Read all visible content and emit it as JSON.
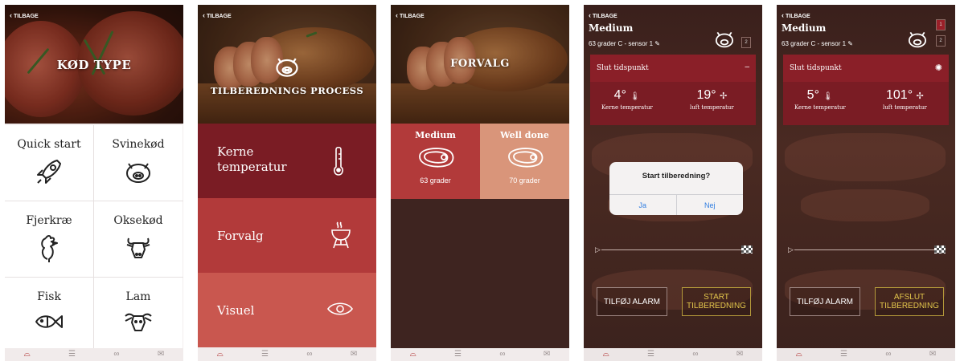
{
  "common": {
    "back_label": "TILBAGE",
    "tab_icons": [
      "pot-icon",
      "sliders-icon",
      "sensor-icon",
      "mail-icon"
    ]
  },
  "colors": {
    "dark_red": "#7a1c24",
    "mid_red": "#b23a3a",
    "light_red": "#c9574f",
    "peach": "#d9957a",
    "dark_brown": "#3e2420",
    "gold": "#e2c54b"
  },
  "screen1": {
    "title": "KØD TYPE",
    "categories": [
      {
        "label": "Quick start",
        "icon": "rocket-icon"
      },
      {
        "label": "Svinekød",
        "icon": "pig-icon"
      },
      {
        "label": "Fjerkræ",
        "icon": "chicken-icon"
      },
      {
        "label": "Oksekød",
        "icon": "cow-icon"
      },
      {
        "label": "Fisk",
        "icon": "fish-icon"
      },
      {
        "label": "Lam",
        "icon": "sheep-icon"
      }
    ]
  },
  "screen2": {
    "title": "TILBEREDNINGS PROCESS",
    "options": [
      {
        "label": "Kerne temperatur",
        "icon": "thermometer-icon"
      },
      {
        "label": "Forvalg",
        "icon": "grill-icon"
      },
      {
        "label": "Visuel",
        "icon": "eye-icon"
      }
    ]
  },
  "screen3": {
    "title": "FORVALG",
    "options": [
      {
        "label": "Medium",
        "value": "63 grader",
        "icon": "steak-icon"
      },
      {
        "label": "Well done",
        "value": "70 grader",
        "icon": "steak-icon"
      }
    ]
  },
  "screen4": {
    "title": "Medium",
    "subtitle": "63 grader C - sensor 1",
    "panel_label": "Slut tidspunkt",
    "panel_right": "–",
    "core_temp": "4°",
    "core_label": "Kerne temperatur",
    "air_temp": "19°",
    "air_label": "luft temperatur",
    "sensor_box": "2",
    "dialog": {
      "question": "Start tilberedning?",
      "yes": "Ja",
      "no": "Nej"
    },
    "btn_alarm": "TILFØJ ALARM",
    "btn_start": "START TILBEREDNING"
  },
  "screen5": {
    "title": "Medium",
    "subtitle": "63 grader C - sensor 1",
    "panel_label": "Slut tidspunkt",
    "core_temp": "5°",
    "core_label": "Kerne temperatur",
    "air_temp": "101°",
    "air_label": "luft temperatur",
    "sensor_box_1": "1",
    "sensor_box_2": "2",
    "btn_alarm": "TILFØJ ALARM",
    "btn_end": "AFSLUT TILBEREDNING"
  }
}
